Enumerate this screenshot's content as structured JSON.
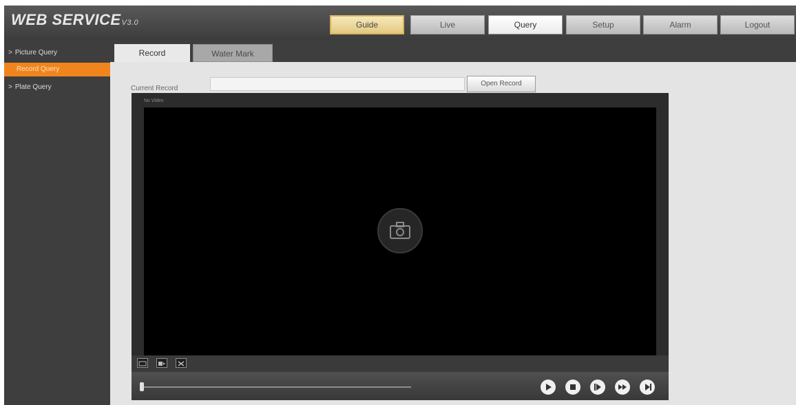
{
  "header": {
    "logo_text": "WEB  SERVICE",
    "logo_version": "V3.0",
    "tabs": [
      {
        "label": "Guide"
      },
      {
        "label": "Live"
      },
      {
        "label": "Query"
      },
      {
        "label": "Setup"
      },
      {
        "label": "Alarm"
      },
      {
        "label": "Logout"
      }
    ],
    "active_tab": "Query"
  },
  "sidebar": {
    "items": [
      {
        "label": "Picture Query"
      },
      {
        "label": "Record Query"
      },
      {
        "label": "Plate Query"
      }
    ],
    "active_item": "Record Query",
    "arrow_glyph": ">"
  },
  "subtabs": {
    "items": [
      {
        "label": "Record"
      },
      {
        "label": "Water Mark"
      }
    ],
    "active": "Record"
  },
  "current_record": {
    "label": "Current Record",
    "value": "",
    "open_button": "Open Record"
  },
  "player": {
    "status_text": "No Video",
    "progress": 0,
    "toolbar_icons": [
      "screenshot-icon",
      "clip-icon",
      "fullscreen-icon"
    ],
    "controls": [
      "play-icon",
      "stop-icon",
      "step-forward-icon",
      "fast-forward-icon",
      "slow-icon"
    ]
  },
  "colors": {
    "accent": "#f0851e",
    "header_bg": "#4a4a4a",
    "video_bg": "#000000",
    "guide_tab": "#ecd796"
  }
}
